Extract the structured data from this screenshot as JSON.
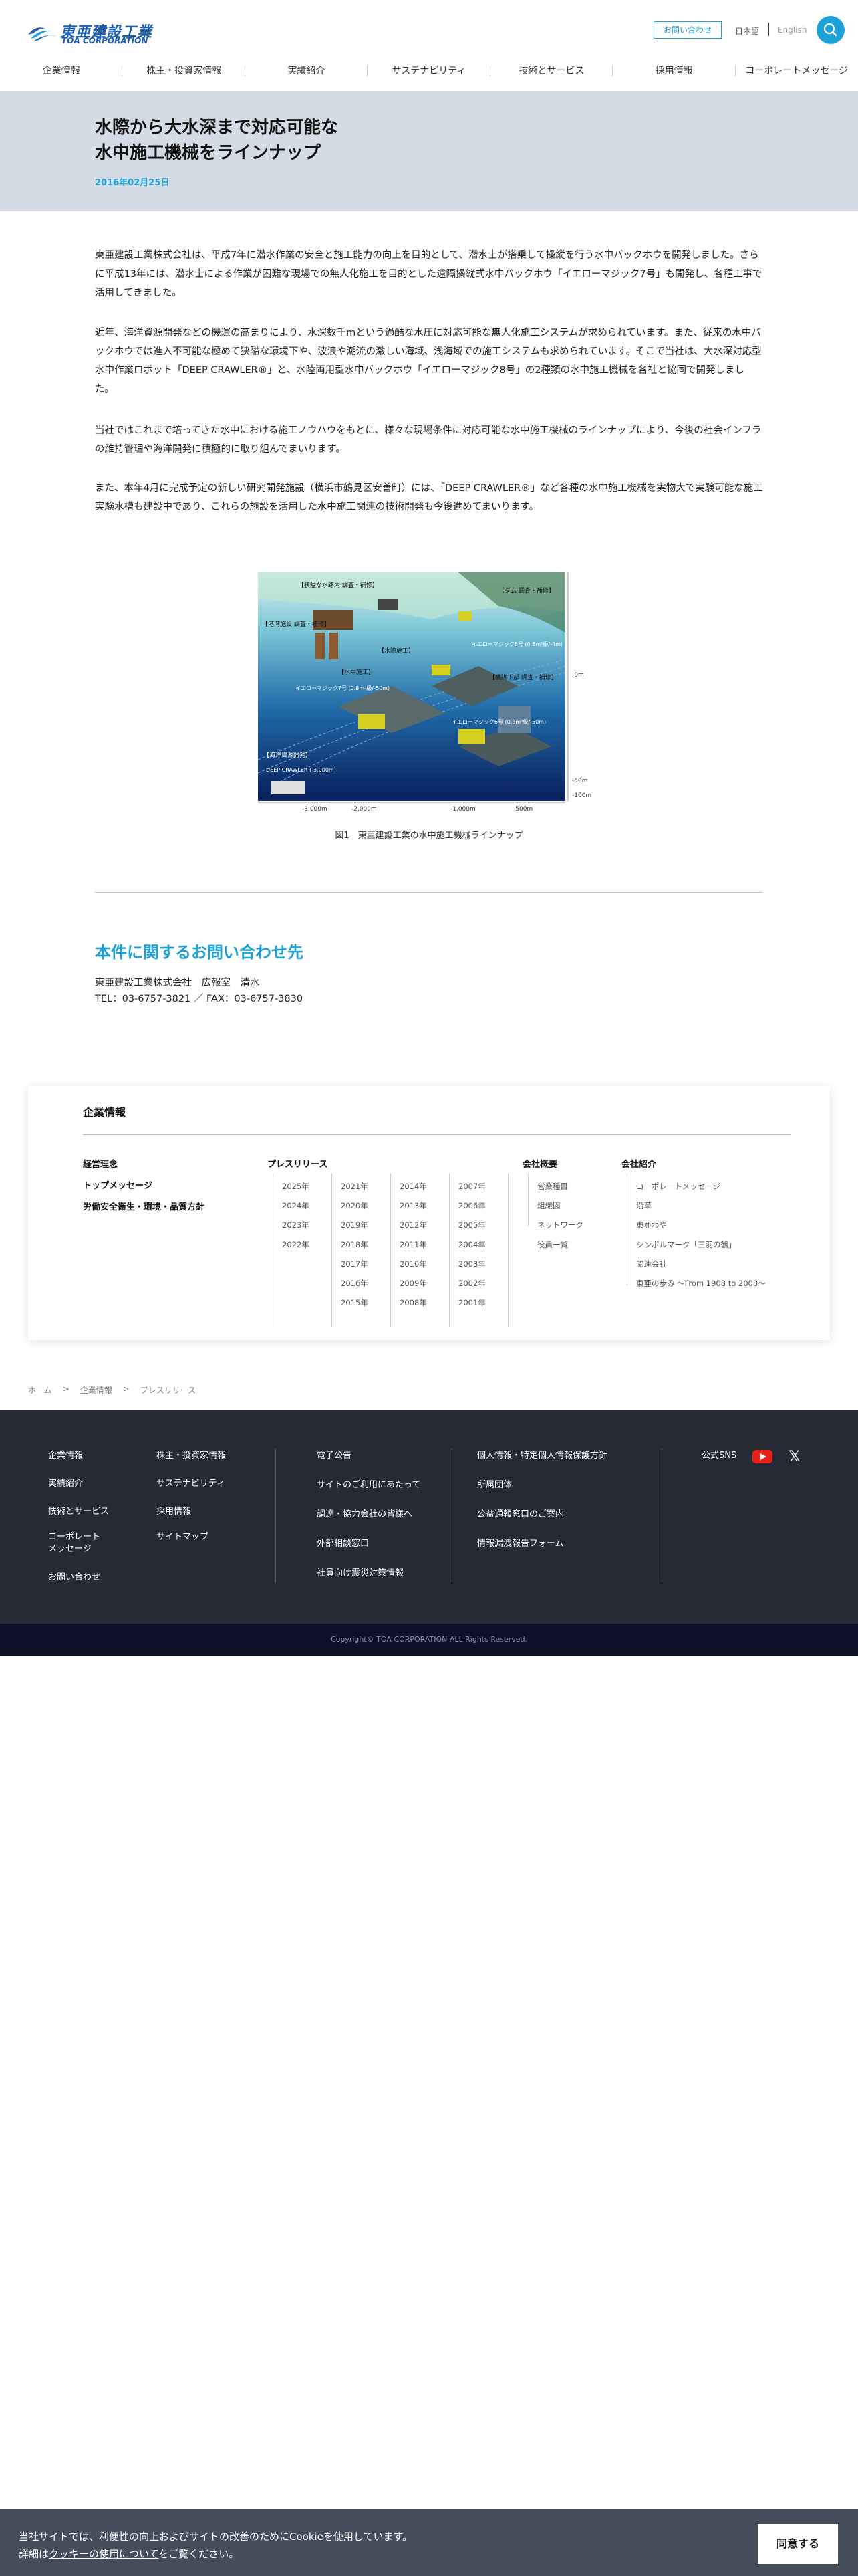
{
  "header": {
    "logo_jp": "東亜建設工業",
    "logo_en": "TOA CORPORATION",
    "contact_label": "お問い合わせ",
    "lang_jp": "日本語",
    "lang_en": "English",
    "nav": [
      "企業情報",
      "株主・投資家情報",
      "実績紹介",
      "サステナビリティ",
      "技術とサービス",
      "採用情報",
      "コーポレートメッセージ"
    ]
  },
  "article": {
    "title": "水際から大水深まで対応可能な\n水中施工機械をラインナップ",
    "date": "2016年02月25日",
    "paragraphs": [
      "東亜建設工業株式会社は、平成7年に潜水作業の安全と施工能力の向上を目的として、潜水士が搭乗して操縦を行う水中バックホウを開発しました。さらに平成13年には、潜水士による作業が困難な現場での無人化施工を目的とした遠隔操縦式水中バックホウ「イエローマジック7号」も開発し、各種工事で活用してきました。",
      "近年、海洋資源開発などの機運の高まりにより、水深数千mという過酷な水圧に対応可能な無人化施工システムが求められています。また、従来の水中バックホウでは進入不可能な極めて狭隘な環境下や、波浪や潮流の激しい海域、浅海域での施工システムも求められています。そこで当社は、大水深対応型水中作業ロボット「DEEP CRAWLER®」と、水陸両用型水中バックホウ「イエローマジック8号」の2種類の水中施工機械を各社と協同で開発しました。",
      "当社ではこれまで培ってきた水中における施工ノウハウをもとに、様々な現場条件に対応可能な水中施工機械のラインナップにより、今後の社会インフラの維持管理や海洋開発に積極的に取り組んでまいります。",
      "また、本年4月に完成予定の新しい研究開発施設（横浜市鶴見区安善町）には、「DEEP CRAWLER®」など各種の水中施工機械を実物大で実験可能な施工実験水槽も建設中であり、これらの施設を活用した水中施工関連の技術開発も今後進めてまいります。"
    ],
    "figure": {
      "caption": "図1　東亜建設工業の水中施工機械ラインナップ",
      "labels": [
        "【狭隘な水路内 調査・補修】",
        "【ダム 調査・補修】",
        "【港湾施設 調査・補修】",
        "【水際施工】",
        "イエローマジック8号\n(0.8m³級/-4m)",
        "【水中施工】",
        "イエローマジック7号\n(0.8m³級/-50m)",
        "【橋脚下部 調査・補修】",
        "イエローマジック6号\n(0.8m³級/-50m)",
        "【海洋資源開発】",
        "DEEP CRAWLER\n(-3,000m)"
      ],
      "depth_labels": [
        "-0m",
        "-50m",
        "-100m"
      ],
      "distance_labels": [
        "-3,000m",
        "-2,000m",
        "-1,000m",
        "-500m"
      ]
    }
  },
  "contact": {
    "title": "本件に関するお問い合わせ先",
    "org": "東亜建設工業株式会社　広報室　清水",
    "tel": "TEL：03‐6757‐3821 ／ FAX：03‐6757‐3830"
  },
  "corp_card": {
    "title": "企業情報",
    "left_links": [
      "経営理念",
      "トップメッセージ",
      "労働安全衛生・環境・品質方針"
    ],
    "press_head": "プレスリリース",
    "years": [
      [
        "2025年",
        "2024年",
        "2023年",
        "2022年"
      ],
      [
        "2021年",
        "2020年",
        "2019年",
        "2018年",
        "2017年",
        "2016年",
        "2015年"
      ],
      [
        "2014年",
        "2013年",
        "2012年",
        "2011年",
        "2010年",
        "2009年",
        "2008年"
      ],
      [
        "2007年",
        "2006年",
        "2005年",
        "2004年",
        "2003年",
        "2002年",
        "2001年"
      ]
    ],
    "overview_head": "会社概要",
    "overview_links": [
      "営業種目",
      "組織図",
      "ネットワーク",
      "役員一覧"
    ],
    "intro_head": "会社紹介",
    "intro_links": [
      "コーポレートメッセージ",
      "沿革",
      "東亜わや",
      "シンボルマーク「三羽の鶴」",
      "関連会社",
      "東亜の歩み 〜From 1908 to 2008〜"
    ]
  },
  "breadcrumb": [
    "ホーム",
    "企業情報",
    "プレスリリース"
  ],
  "breadcrumb_sep": ">",
  "footer": {
    "col1": [
      "企業情報",
      "実績紹介",
      "技術とサービス",
      "コーポレート\nメッセージ",
      "お問い合わせ"
    ],
    "col2": [
      "株主・投資家情報",
      "サステナビリティ",
      "採用情報",
      "サイトマップ"
    ],
    "col3": [
      "電子公告",
      "サイトのご利用にあたって",
      "調達・協力会社の皆様へ",
      "外部相談窓口",
      "社員向け震災対策情報"
    ],
    "col4": [
      "個人情報・特定個人情報保護方針",
      "所属団体",
      "公益通報窓口のご案内",
      "情報漏洩報告フォーム"
    ],
    "sns_label": "公式SNS",
    "x_label": "𝕏",
    "copyright": "Copyright© TOA CORPORATION ALL Rights Reserved."
  },
  "cookie": {
    "line1": "当社サイトでは、利便性の向上およびサイトの改善のためにCookieを使用しています。",
    "line2_pre": "詳細は",
    "line2_link": "クッキーの使用について",
    "line2_post": "をご覧ください。",
    "accept": "同意する"
  }
}
